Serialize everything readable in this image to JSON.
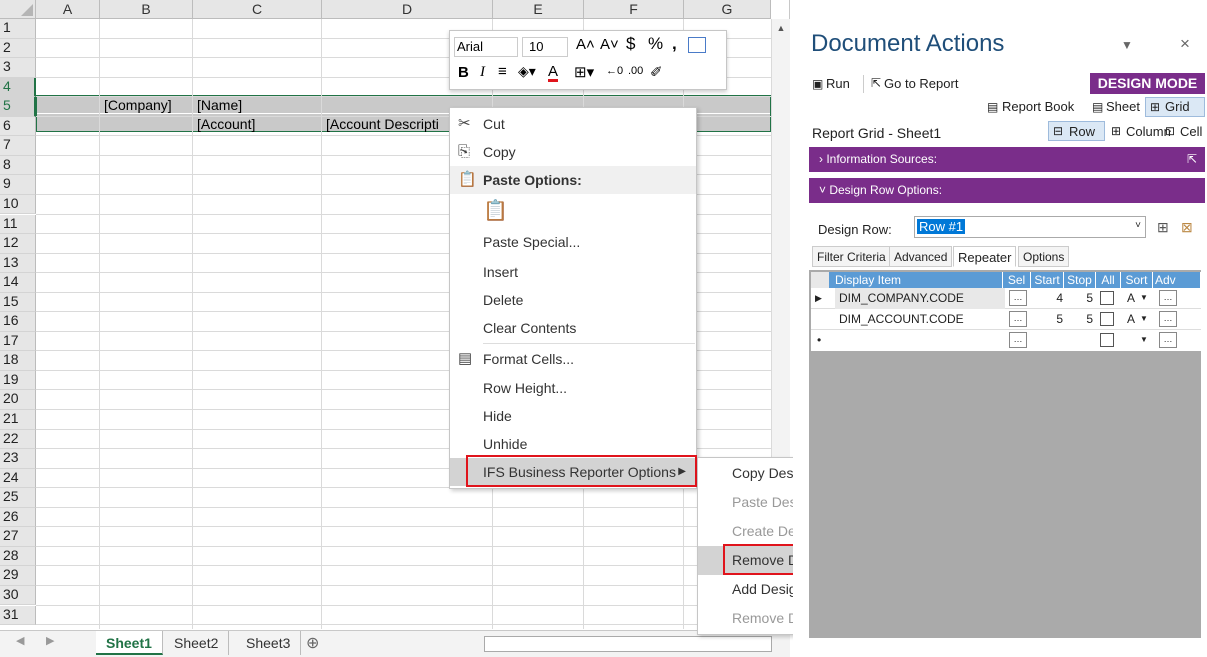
{
  "spreadsheet": {
    "columns": [
      "A",
      "B",
      "C",
      "D",
      "E",
      "F",
      "G"
    ],
    "rows": [
      "1",
      "2",
      "3",
      "4",
      "5",
      "6",
      "7",
      "8",
      "9",
      "10",
      "11",
      "12",
      "13",
      "14",
      "15",
      "16",
      "17",
      "18",
      "19",
      "20",
      "21",
      "22",
      "23",
      "24",
      "25",
      "26",
      "27",
      "28",
      "29",
      "30",
      "31"
    ],
    "cells": {
      "b4": "[Company]",
      "c4": "[Name]",
      "c5": "[Account]",
      "d5": "[Account Descripti"
    },
    "sheet_tabs": [
      "Sheet1",
      "Sheet2",
      "Sheet3"
    ],
    "active_tab": "Sheet1",
    "add_sheet_icon": "⊕"
  },
  "mini_toolbar": {
    "font_name": "Arial",
    "font_size": "10",
    "bold": "B",
    "italic": "I"
  },
  "context_menu": {
    "items": [
      {
        "label": "Cut",
        "icon": "scissors-icon"
      },
      {
        "label": "Copy",
        "icon": "copy-icon"
      },
      {
        "label": "Paste Options:",
        "icon": "paste-icon"
      },
      {
        "label": "Paste Special..."
      },
      {
        "label": "Insert"
      },
      {
        "label": "Delete"
      },
      {
        "label": "Clear Contents"
      },
      {
        "label": "Format Cells...",
        "icon": "format-cells-icon"
      },
      {
        "label": "Row Height..."
      },
      {
        "label": "Hide"
      },
      {
        "label": "Unhide"
      },
      {
        "label": "IFS Business Reporter Options"
      }
    ]
  },
  "submenu": {
    "items": [
      {
        "label": "Copy Design Row",
        "enabled": true
      },
      {
        "label": "Paste Design Row",
        "enabled": false
      },
      {
        "label": "Create Design Row",
        "enabled": false
      },
      {
        "label": "Remove Design Row",
        "enabled": true
      },
      {
        "label": "Add Design Row Grouping",
        "enabled": true
      },
      {
        "label": "Remove Design Row Grouping",
        "enabled": false
      }
    ]
  },
  "panel": {
    "title": "Document Actions",
    "run": "Run",
    "goto_report": "Go to Report",
    "design_mode": "DESIGN MODE",
    "report_book": "Report Book",
    "sheet": "Sheet",
    "grid": "Grid",
    "report_grid_label": "Report Grid - Sheet1",
    "row": "Row",
    "column": "Column",
    "cell": "Cell",
    "info_sources": "Information Sources:",
    "design_row_options": "Design Row Options:",
    "design_row_label": "Design Row:",
    "design_row_value": "Row #1",
    "tabs": [
      "Filter Criteria",
      "Advanced",
      "Repeater",
      "Options"
    ],
    "active_tab": "Repeater",
    "grid_headers": [
      "Display Item",
      "Sel",
      "Start",
      "Stop",
      "All",
      "Sort",
      "Adv"
    ],
    "grid_rows": [
      {
        "item": "DIM_COMPANY.CODE",
        "start": "4",
        "stop": "5",
        "sort": "A"
      },
      {
        "item": "DIM_ACCOUNT.CODE",
        "start": "5",
        "stop": "5",
        "sort": "A"
      }
    ],
    "accent_color": "#7a2d8a"
  }
}
